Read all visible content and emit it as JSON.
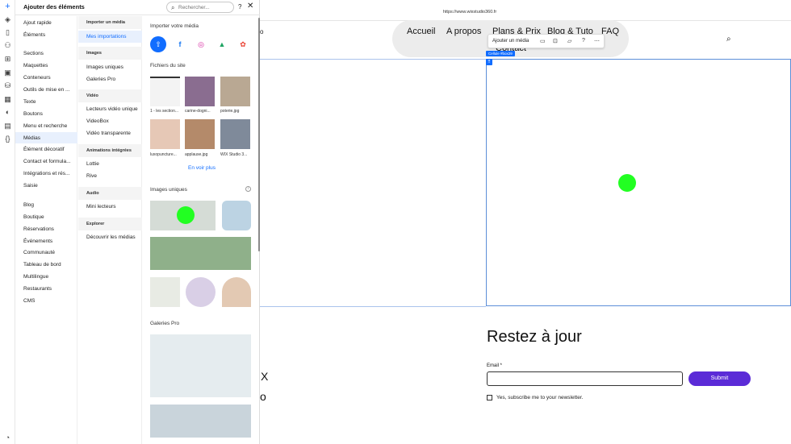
{
  "panel": {
    "title": "Ajouter des éléments",
    "search_placeholder": "Rechercher...",
    "help": "?",
    "close": "✕"
  },
  "rail": {
    "icons": [
      "plus-icon",
      "layers-icon",
      "page-icon",
      "connect-icon",
      "apps-icon",
      "media-icon",
      "cms-icon",
      "blocks-icon",
      "design-icon",
      "table-icon",
      "code-icon"
    ]
  },
  "categories": {
    "items": [
      "Ajout rapide",
      "Éléments",
      "Sections",
      "Maquettes",
      "Conteneurs",
      "Outils de mise en ...",
      "Texte",
      "Boutons",
      "Menu et recherche",
      "Médias",
      "Élément décoratif",
      "Contact et formula...",
      "Intégrations et rés...",
      "Saisie",
      "Blog",
      "Boutique",
      "Réservations",
      "Événements",
      "Communauté",
      "Tableau de bord",
      "Multilingue",
      "Restaurants",
      "CMS"
    ],
    "selected": "Médias"
  },
  "subcategories": {
    "import_header": "Importer un média",
    "my_imports": "Mes importations",
    "images_header": "Images",
    "unique_images": "Images uniques",
    "pro_galleries": "Galeries Pro",
    "video_header": "Vidéo",
    "single_player": "Lecteurs vidéo unique",
    "videobox": "VideoBox",
    "transparent_video": "Vidéo transparente",
    "animations_header": "Animations intégrées",
    "lottie": "Lottie",
    "rive": "Rive",
    "audio_header": "Audio",
    "mini_players": "Mini lecteurs",
    "explore_header": "Explorer",
    "discover": "Découvrir les médias"
  },
  "media": {
    "import_title": "Importer votre média",
    "site_files_title": "Fichiers du site",
    "files": [
      "1 - les section...",
      "carine-dogni...",
      "poterie.jpg",
      "luxopuncture...",
      "applause.jpg",
      "WIX Studio 3..."
    ],
    "see_more": "En voir plus",
    "unique_images_title": "Images uniques",
    "info": "i",
    "pro_galleries_title": "Galeries Pro"
  },
  "site": {
    "url": "https://www.wixstudio360.fr",
    "nav": [
      "Accueil",
      "A propos",
      "Plans & Prix",
      "Blog & Tuto",
      "FAQ"
    ],
    "contact": "Contact",
    "nav_left_fragment": "o",
    "toolbar_label": "Ajouter un média",
    "cell_tag": "Cellule #box29",
    "left_x": "X",
    "left_o": "o",
    "newsletter_title": "Restez à jour",
    "email_label": "Email *",
    "submit": "Submit",
    "consent": "Yes, subscribe me to your newsletter."
  },
  "colors": {
    "accent": "#116dff",
    "submit": "#5b2bd7",
    "selected_bg": "#e8f0fd",
    "cursor": "#22ff22"
  }
}
